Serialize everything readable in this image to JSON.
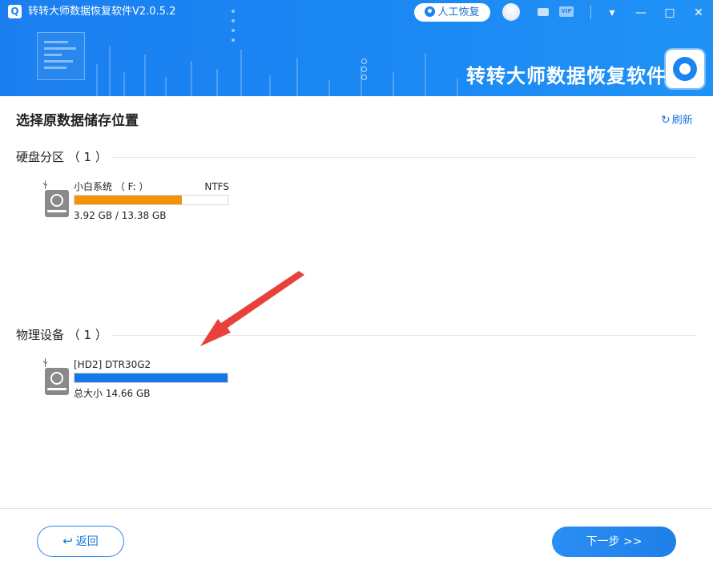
{
  "window": {
    "title": "转转大师数据恢复软件V2.0.5.2",
    "logo_letter": "Q",
    "service_label": "人工恢复",
    "vip_label": "VIP",
    "minimize": "▾",
    "restore": "—",
    "maximize": "□",
    "close": "✕"
  },
  "banner": {
    "brand": "转转大师数据恢复软件"
  },
  "main": {
    "title": "选择原数据储存位置",
    "refresh_label": "刷新",
    "sections": [
      {
        "title": "硬盘分区 （ 1 ）",
        "drives": [
          {
            "name": "小白系统 （ F: ）",
            "fs": "NTFS",
            "size": "3.92 GB / 13.38 GB",
            "usage_fraction": 0.7,
            "bar_color": "#f5920b"
          }
        ]
      },
      {
        "title": "物理设备 （ 1 ）",
        "drives": [
          {
            "name": "[HD2] DTR30G2",
            "fs": "",
            "size": "总大小 14.66 GB",
            "usage_fraction": 1.0,
            "bar_color": "#1578e6"
          }
        ]
      }
    ]
  },
  "footer": {
    "back_label": "返回",
    "next_label": "下一步 >>"
  },
  "colors": {
    "accent": "#1a84f2",
    "annotation_arrow": "#e8413b"
  }
}
